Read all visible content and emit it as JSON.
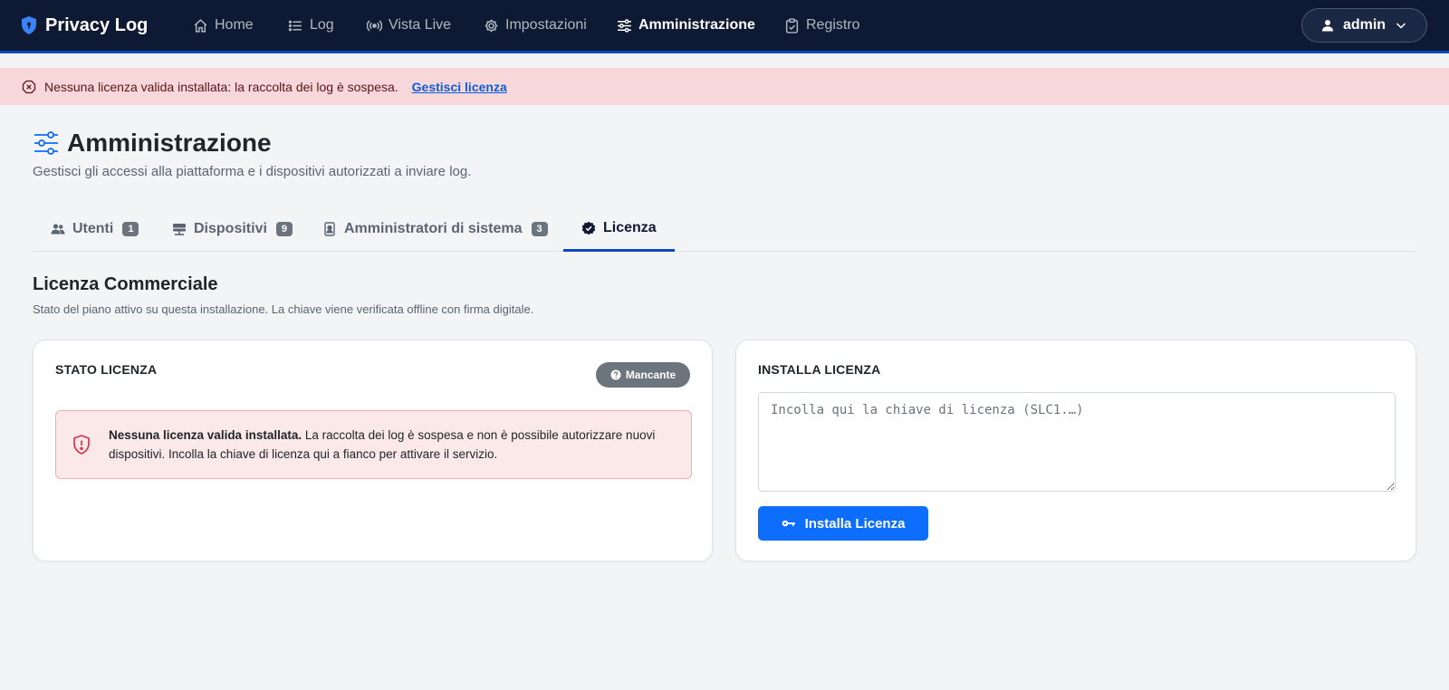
{
  "navbar": {
    "brand": "Privacy Log",
    "items": [
      {
        "label": "Home",
        "icon": "home-icon"
      },
      {
        "label": "Log",
        "icon": "list-icon"
      },
      {
        "label": "Vista Live",
        "icon": "broadcast-icon"
      },
      {
        "label": "Impostazioni",
        "icon": "gear-icon"
      },
      {
        "label": "Amministrazione",
        "icon": "sliders-icon",
        "active": true
      },
      {
        "label": "Registro",
        "icon": "clipboard-check-icon"
      }
    ],
    "user": "admin"
  },
  "alert": {
    "text": "Nessuna licenza valida installata: la raccolta dei log è sospesa.",
    "link": "Gestisci licenza"
  },
  "header": {
    "title": "Amministrazione",
    "subtitle": "Gestisci gli accessi alla piattaforma e i dispositivi autorizzati a inviare log."
  },
  "tabs": [
    {
      "label": "Utenti",
      "count": "1",
      "icon": "users-icon"
    },
    {
      "label": "Dispositivi",
      "count": "9",
      "icon": "server-icon"
    },
    {
      "label": "Amministratori di sistema",
      "count": "3",
      "icon": "person-badge-icon"
    },
    {
      "label": "Licenza",
      "icon": "patch-check-icon",
      "active": true
    }
  ],
  "section": {
    "title": "Licenza Commerciale",
    "subtitle": "Stato del piano attivo su questa installazione. La chiave viene verificata offline con firma digitale."
  },
  "status_card": {
    "heading": "STATO LICENZA",
    "badge": "Mancante",
    "warning_bold": "Nessuna licenza valida installata.",
    "warning_text": " La raccolta dei log è sospesa e non è possibile autorizzare nuovi dispositivi. Incolla la chiave di licenza qui a fianco per attivare il servizio."
  },
  "install_card": {
    "heading": "INSTALLA LICENZA",
    "placeholder": "Incolla qui la chiave di licenza (SLC1.…)",
    "value": "",
    "button": "Installa Licenza"
  },
  "colors": {
    "navbar": "#0e1a33",
    "accent": "#0d47c2",
    "primary_button": "#0d6efd",
    "alert_bg": "#f8d7da",
    "danger": "#dc3545",
    "badge": "#6c757d"
  }
}
